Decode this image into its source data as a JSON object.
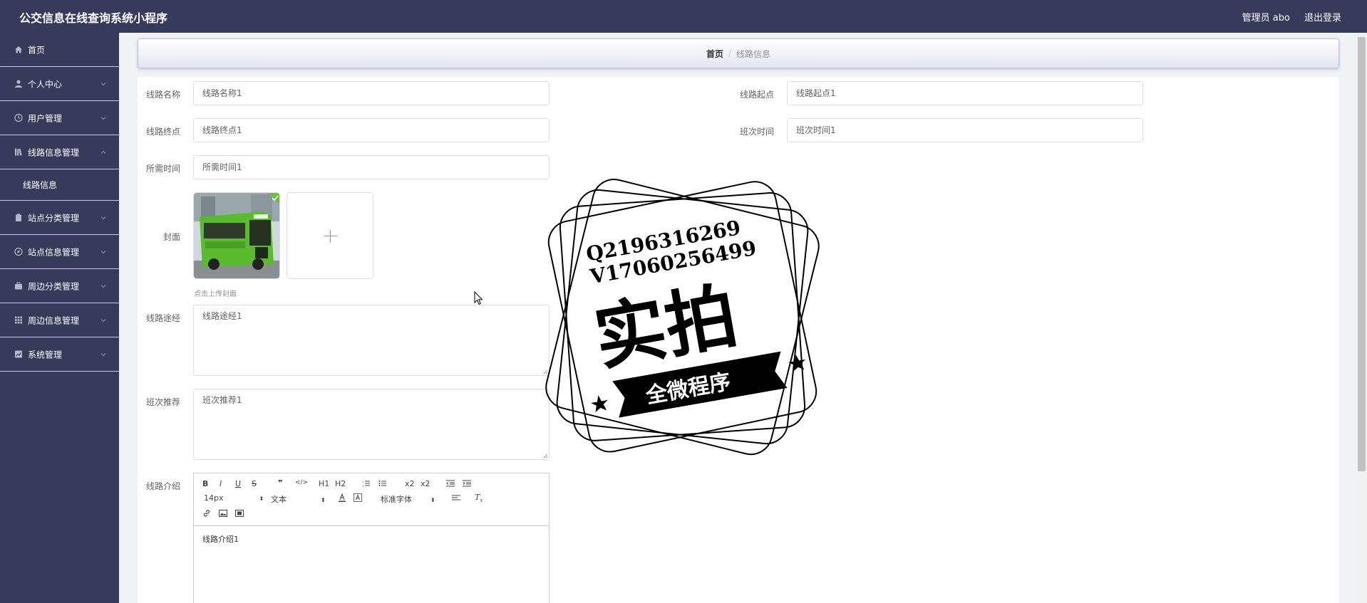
{
  "app": {
    "title": "公交信息在线查询系统小程序"
  },
  "header": {
    "user_label": "管理员 abo",
    "logout_label": "退出登录"
  },
  "sidebar": {
    "items": [
      {
        "label": "首页",
        "icon": "home-icon"
      },
      {
        "label": "个人中心",
        "icon": "user-icon"
      },
      {
        "label": "用户管理",
        "icon": "clock-icon"
      },
      {
        "label": "线路信息管理",
        "icon": "library-icon",
        "expanded": true,
        "children": [
          "线路信息"
        ]
      },
      {
        "label": "站点分类管理",
        "icon": "clipboard-icon"
      },
      {
        "label": "站点信息管理",
        "icon": "compass-icon"
      },
      {
        "label": "周边分类管理",
        "icon": "briefcase-icon"
      },
      {
        "label": "周边信息管理",
        "icon": "grid-icon"
      },
      {
        "label": "系统管理",
        "icon": "chart-icon"
      }
    ]
  },
  "breadcrumb": {
    "home": "首页",
    "separator": "/",
    "current": "线路信息"
  },
  "form": {
    "route_name": {
      "label": "线路名称",
      "value": "线路名称1"
    },
    "route_start": {
      "label": "线路起点",
      "value": "线路起点1"
    },
    "route_end": {
      "label": "线路终点",
      "value": "线路终点1"
    },
    "schedule_time": {
      "label": "班次时间",
      "value": "班次时间1"
    },
    "required_time": {
      "label": "所需时间",
      "value": "所需时间1"
    },
    "cover": {
      "label": "封面",
      "hint": "点击上传封面"
    },
    "route_via": {
      "label": "线路途经",
      "value": "线路途经1"
    },
    "schedule_recommend": {
      "label": "班次推荐",
      "value": "班次推荐1"
    },
    "route_intro": {
      "label": "线路介绍",
      "value": "线路介绍1"
    }
  },
  "editor": {
    "font_size": "14px",
    "text_type": "文本",
    "font_family": "标准字体",
    "buttons": [
      "B",
      "I",
      "U",
      "S",
      "❞",
      "</>",
      "H1",
      "H2",
      "x2",
      "x2"
    ]
  },
  "stamp": {
    "line1": "Q2196316269",
    "line2": "V17060256499",
    "big": "实拍",
    "banner": "全微程序"
  },
  "colors": {
    "sidebar": "#363b5c",
    "divider": "#c9cbd6",
    "accent": "#b9c0e8"
  }
}
